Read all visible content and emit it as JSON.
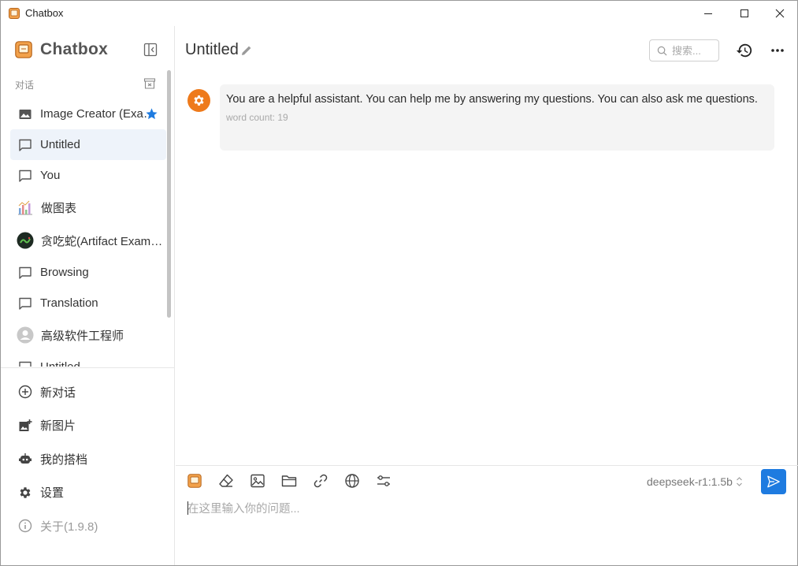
{
  "window": {
    "title": "Chatbox",
    "minimize_icon": "minimize-icon",
    "maximize_icon": "maximize-icon",
    "close_icon": "close-icon"
  },
  "sidebar": {
    "brand": "Chatbox",
    "section_label": "对话",
    "sessions": [
      {
        "label": "Image Creator (Example)",
        "icon": "image-icon",
        "starred": true
      },
      {
        "label": "Untitled",
        "icon": "chat-bubble-icon",
        "active": true
      },
      {
        "label": "You",
        "icon": "chat-bubble-icon"
      },
      {
        "label": "做图表",
        "icon": "chart-avatar-icon"
      },
      {
        "label": "贪吃蛇(Artifact Example)",
        "icon": "snake-avatar-icon"
      },
      {
        "label": "Browsing",
        "icon": "chat-bubble-icon"
      },
      {
        "label": "Translation",
        "icon": "chat-bubble-icon"
      },
      {
        "label": "高级软件工程师",
        "icon": "person-avatar-icon"
      },
      {
        "label": "Untitled",
        "icon": "chat-bubble-icon"
      }
    ],
    "menu": [
      {
        "label": "新对话",
        "icon": "plus-circle-icon"
      },
      {
        "label": "新图片",
        "icon": "add-photo-icon"
      },
      {
        "label": "我的搭档",
        "icon": "robot-icon"
      },
      {
        "label": "设置",
        "icon": "gear-icon"
      },
      {
        "label": "关于(1.9.8)",
        "icon": "info-icon"
      }
    ]
  },
  "header": {
    "title": "Untitled",
    "search_placeholder": "搜索..."
  },
  "messages": [
    {
      "role": "system",
      "text": "You are a helpful assistant. You can help me by answering my questions. You can also ask me questions.",
      "meta": "word count: 19"
    }
  ],
  "composer": {
    "model": "deepseek-r1:1.5b",
    "placeholder": "在这里输入你的问题...",
    "tools": [
      "chatbox-logo-icon",
      "eraser-icon",
      "image-icon",
      "folder-icon",
      "link-icon",
      "globe-icon",
      "sliders-icon"
    ]
  },
  "colors": {
    "accent": "#1e7be0",
    "avatar": "#ee7a1b",
    "star": "#1e7be0",
    "active_bg": "#eef3fa",
    "bubble_bg": "#f4f4f4"
  }
}
